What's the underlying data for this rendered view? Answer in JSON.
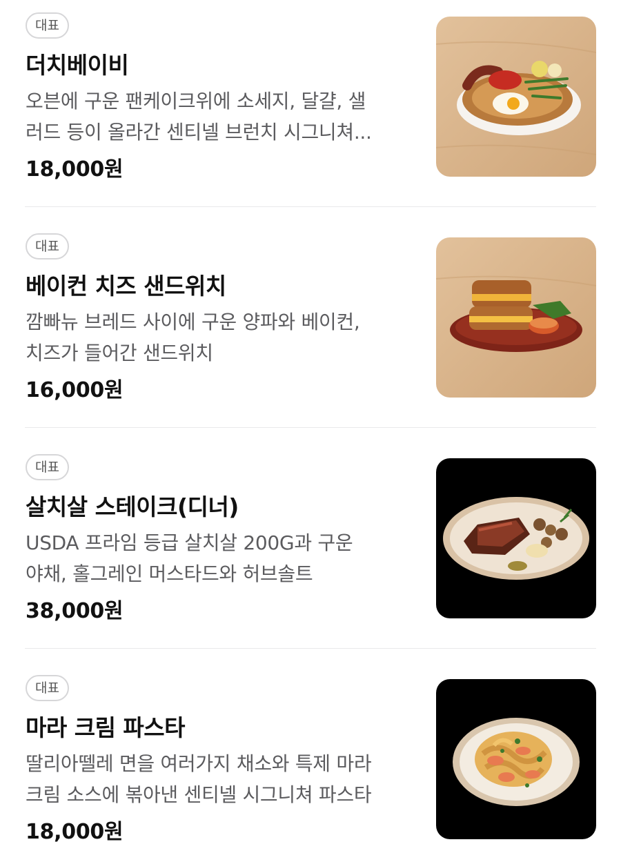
{
  "menu": {
    "items": [
      {
        "badge": "대표",
        "name": "더치베이비",
        "desc_line1": "오븐에 구운 팬케이크위에 소세지, 달걀, 샐",
        "desc_line2": "러드 등이 올라간 센티넬 브런치 시그니쳐...",
        "price": "18,000원",
        "image": "dutch-baby-photo",
        "bg": "#d8b48c"
      },
      {
        "badge": "대표",
        "name": "베이컨 치즈 샌드위치",
        "desc_line1": "깜빠뉴 브레드 사이에 구운 양파와 베이컨,",
        "desc_line2": "치즈가 들어간 샌드위치",
        "price": "16,000원",
        "image": "bacon-cheese-sandwich-photo",
        "bg": "#d8b48c"
      },
      {
        "badge": "대표",
        "name": "살치살 스테이크(디너)",
        "desc_line1": "USDA 프라임 등급 살치살 200G과 구운",
        "desc_line2": "야채, 홀그레인 머스타드와 허브솔트",
        "price": "38,000원",
        "image": "steak-dinner-photo",
        "bg": "#000000"
      },
      {
        "badge": "대표",
        "name": "마라 크림 파스타",
        "desc_line1": "딸리아뗄레 면을 여러가지 채소와 특제 마라",
        "desc_line2": "크림 소스에 볶아낸 센티넬 시그니쳐 파스타",
        "price": "18,000원",
        "image": "mala-cream-pasta-photo",
        "bg": "#000000"
      }
    ]
  }
}
